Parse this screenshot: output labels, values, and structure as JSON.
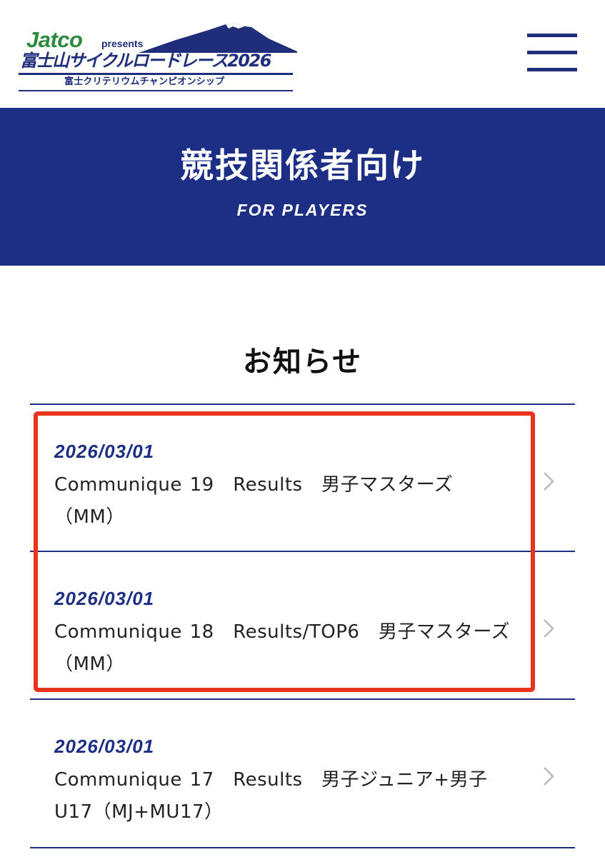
{
  "header": {
    "logo": {
      "brand": "Jatco",
      "presents": "presents",
      "title": "富士山サイクルロードレース2026",
      "subtitle": "富士クリテリウムチャンピオンシップ"
    },
    "menu_icon": "hamburger-menu-icon"
  },
  "hero": {
    "title": "競技関係者向け",
    "subtitle": "FOR PLAYERS"
  },
  "news": {
    "heading": "お知らせ",
    "items": [
      {
        "date": "2026/03/01",
        "text": "Communique 19　Results　男子マスターズ（MM）"
      },
      {
        "date": "2026/03/01",
        "text": "Communique 18　Results/TOP6　男子マスターズ（MM）"
      },
      {
        "date": "2026/03/01",
        "text": "Communique 17　Results　男子ジュニア+男子U17（MJ+MU17）"
      }
    ]
  },
  "colors": {
    "navy": "#1d2f85",
    "brand_green": "#2b8a3e",
    "highlight": "#e8341c"
  }
}
